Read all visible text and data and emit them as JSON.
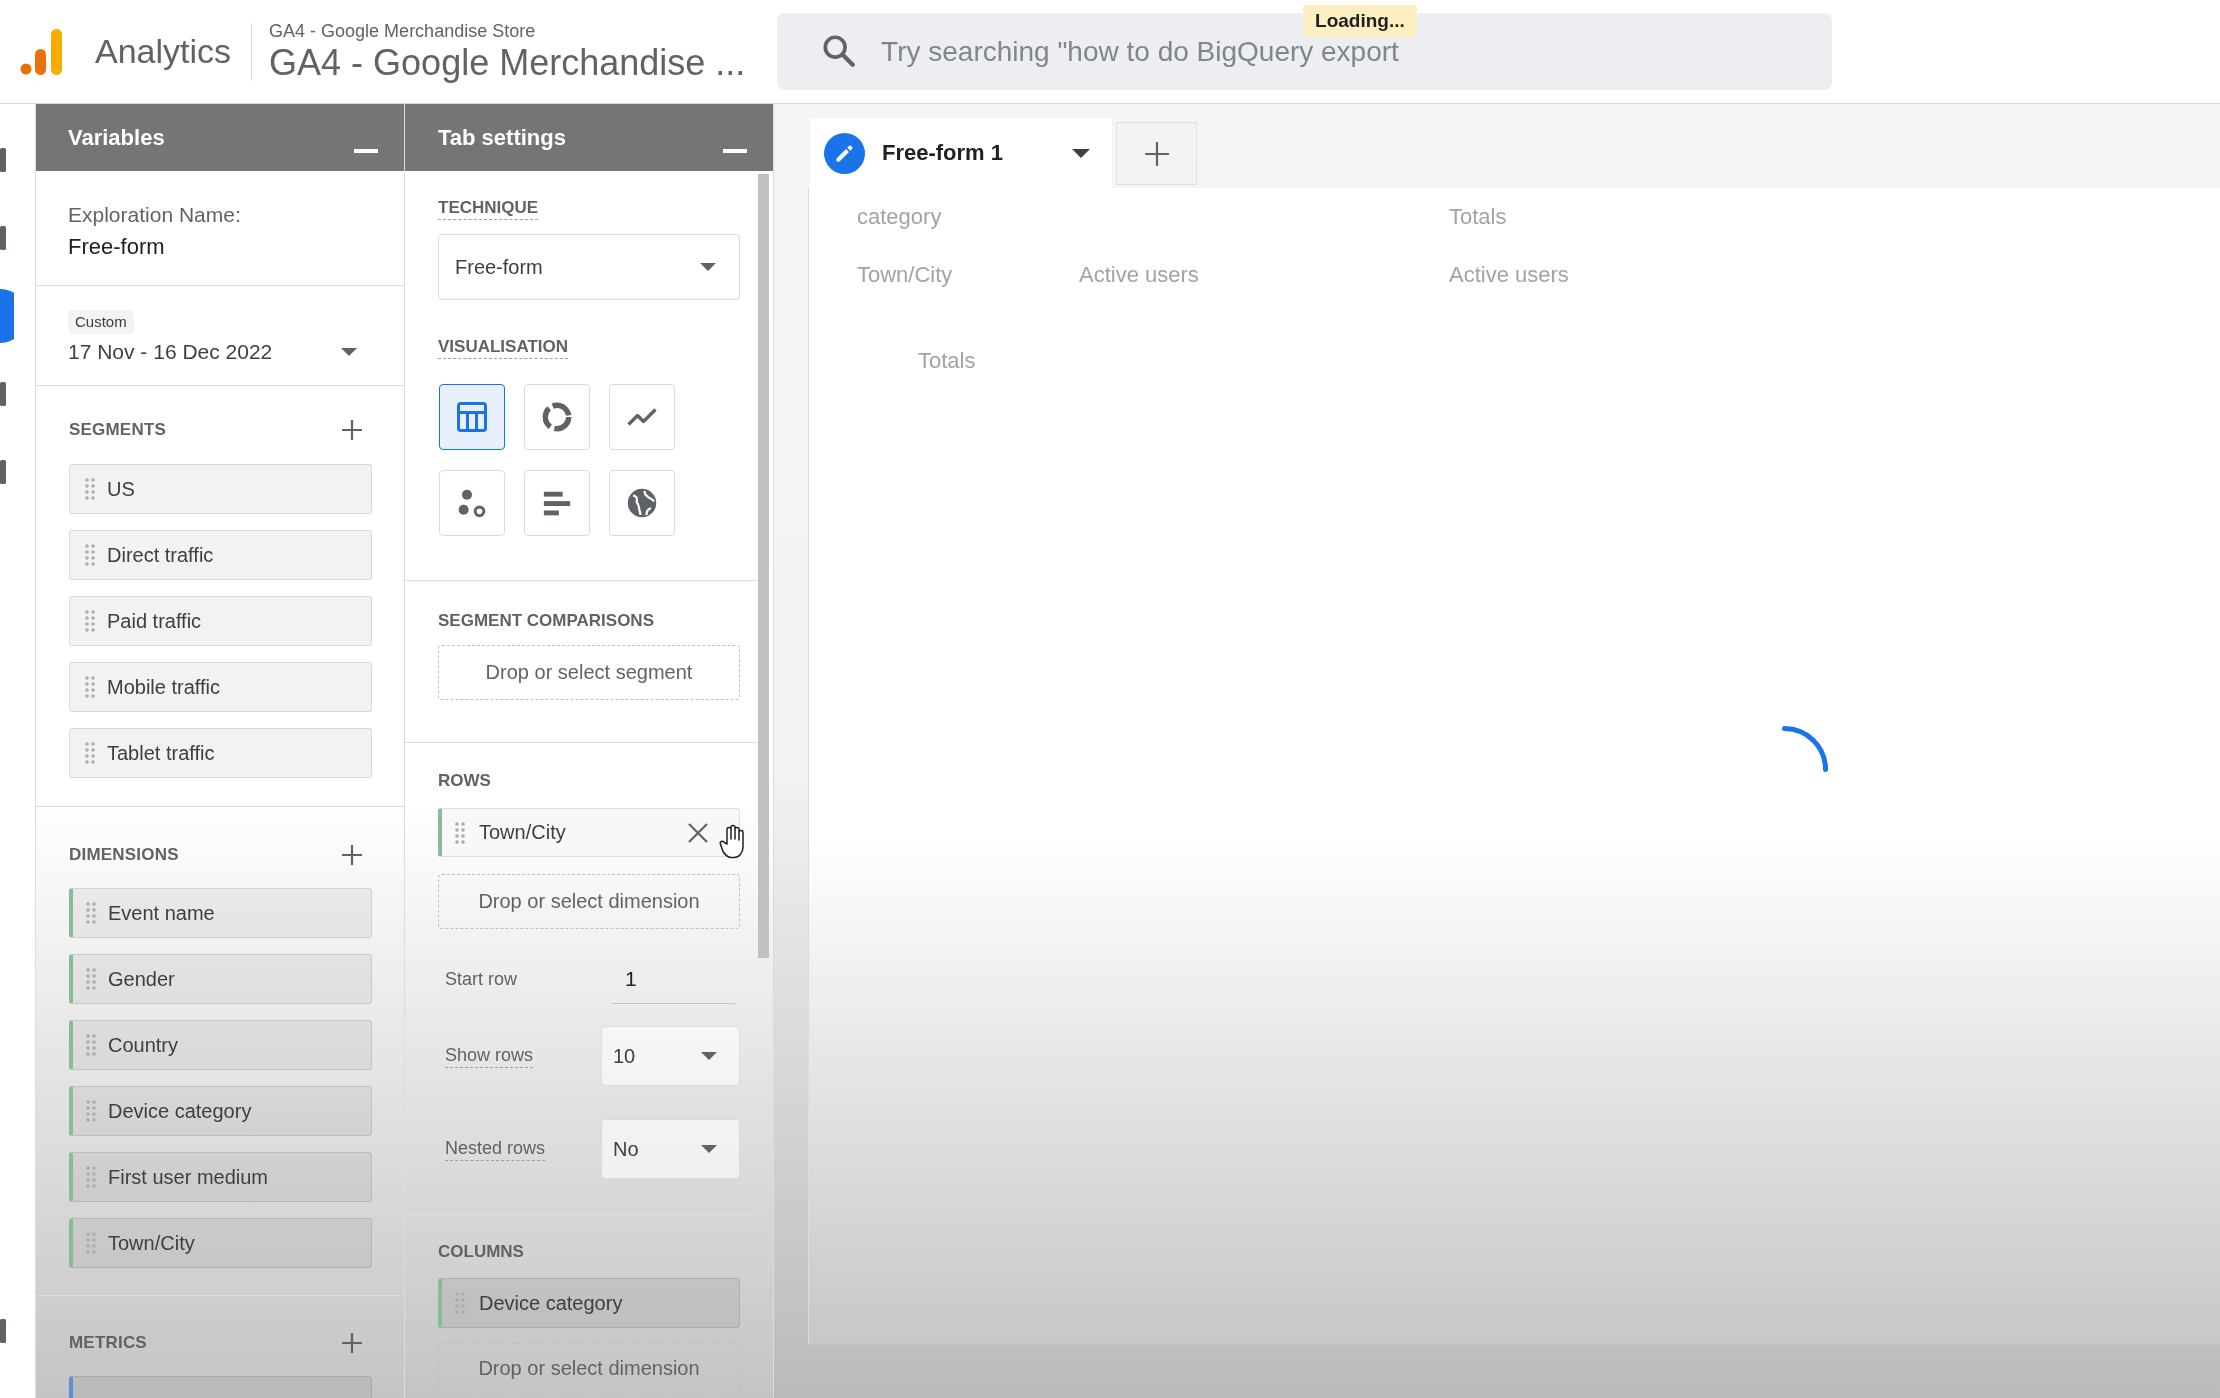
{
  "header": {
    "product": "Analytics",
    "breadcrumb": "GA4 - Google Merchandise Store",
    "property": "GA4 - Google Merchandise ...",
    "search": {
      "placeholder": "Try searching \"how to do BigQuery export"
    },
    "tooltip": "Loading..."
  },
  "nav_rail": {
    "items": [
      {
        "selected": false
      },
      {
        "selected": false
      },
      {
        "selected": true
      },
      {
        "selected": false
      },
      {
        "selected": false
      }
    ],
    "bottom_items": [
      {
        "selected": false
      }
    ]
  },
  "variables": {
    "title": "Variables",
    "exploration_name": {
      "label": "Exploration Name:",
      "value": "Free-form"
    },
    "date_range": {
      "label": "Custom",
      "value": "17 Nov - 16 Dec 2022"
    },
    "segments": {
      "title": "SEGMENTS",
      "items": [
        "US",
        "Direct traffic",
        "Paid traffic",
        "Mobile traffic",
        "Tablet traffic"
      ]
    },
    "dimensions": {
      "title": "DIMENSIONS",
      "items": [
        "Event name",
        "Gender",
        "Country",
        "Device category",
        "First user medium",
        "Town/City"
      ]
    },
    "metrics": {
      "title": "METRICS"
    }
  },
  "tab_settings": {
    "title": "Tab settings",
    "technique": {
      "label": "TECHNIQUE",
      "value": "Free-form"
    },
    "visualisation": {
      "label": "VISUALISATION",
      "options": [
        {
          "kind": "table",
          "selected": true
        },
        {
          "kind": "donut",
          "selected": false
        },
        {
          "kind": "line",
          "selected": false
        },
        {
          "kind": "scatter",
          "selected": false
        },
        {
          "kind": "bar",
          "selected": false
        },
        {
          "kind": "geo",
          "selected": false
        }
      ]
    },
    "segment_comparisons": {
      "label": "SEGMENT COMPARISONS",
      "drop_zone": "Drop or select segment"
    },
    "rows": {
      "label": "ROWS",
      "items": [
        {
          "label": "Town/City",
          "hovered": true
        }
      ],
      "drop_zone": "Drop or select dimension",
      "start_row": {
        "label": "Start row",
        "value": "1"
      },
      "show_rows": {
        "label": "Show rows",
        "value": "10"
      },
      "nested_rows": {
        "label": "Nested rows",
        "value": "No"
      }
    },
    "columns": {
      "label": "COLUMNS",
      "items": [
        {
          "label": "Device category",
          "hovered": false
        }
      ],
      "drop_zone": "Drop or select dimension"
    }
  },
  "canvas": {
    "tabs": [
      {
        "label": "Free-form 1",
        "selected": true
      }
    ],
    "ghost_table": {
      "column_dimension": "category",
      "totals_header": "Totals",
      "row_dimension": "Town/City",
      "metric_headers": [
        "Active users",
        "Active users"
      ],
      "totals_row": "Totals"
    },
    "loading": true
  }
}
